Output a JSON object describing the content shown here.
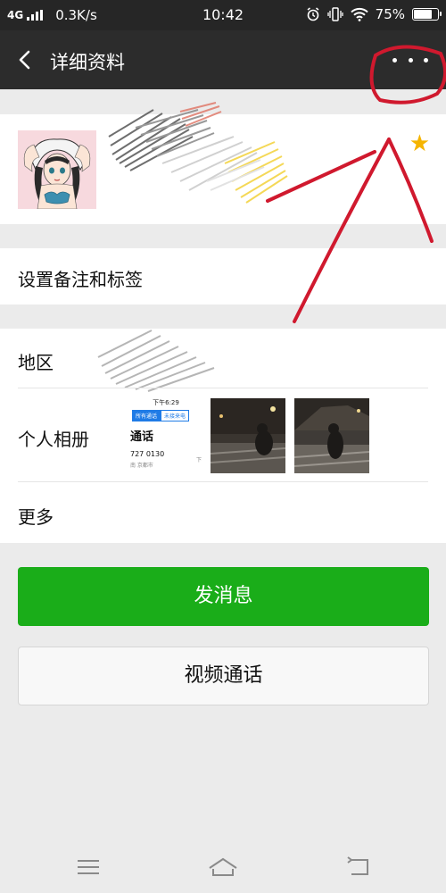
{
  "status_bar": {
    "network": "4G",
    "speed": "0.3K/s",
    "time": "10:42",
    "battery": "75%",
    "battery_level": 0.75
  },
  "header": {
    "title": "详细资料",
    "back_icon": "chevron-left-icon",
    "more_icon": "more-dots-icon"
  },
  "profile": {
    "starred": true,
    "star_color": "#f5b400"
  },
  "rows": {
    "remark": "设置备注和标签",
    "region": "地区",
    "album": "个人相册",
    "more": "更多"
  },
  "album_preview": {
    "screenshot_time": "下午6:29",
    "tab_all": "所有通话",
    "tab_missed": "未接来电",
    "heading": "通话",
    "number": "727 0130",
    "location": "南 京都市",
    "side_mark": "下"
  },
  "actions": {
    "send_message": "发消息",
    "video_call": "视频通话"
  },
  "colors": {
    "primary_green": "#1aad19",
    "header_bg": "#2c2c2c",
    "annotation_red": "#d0192e"
  }
}
